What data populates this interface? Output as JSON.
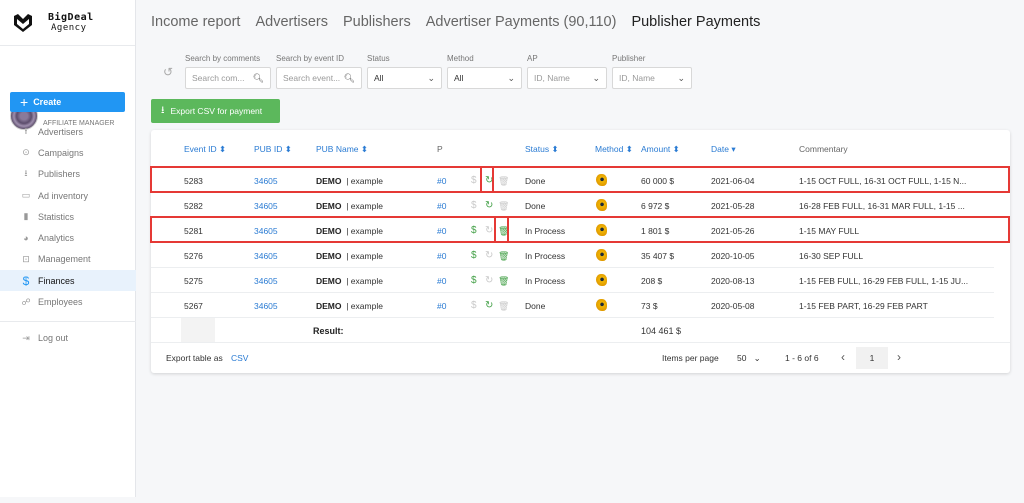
{
  "brand": {
    "line1": "BigDeal",
    "line2": "Agency"
  },
  "profile": {
    "role": "AFFILIATE MANAGER"
  },
  "sidebar": {
    "create_label": "Create",
    "items": [
      {
        "label": "Advertisers",
        "icon": "upload-icon"
      },
      {
        "label": "Campaigns",
        "icon": "play-circle-icon"
      },
      {
        "label": "Publishers",
        "icon": "download-icon"
      },
      {
        "label": "Ad inventory",
        "icon": "window-icon"
      },
      {
        "label": "Statistics",
        "icon": "bar-chart-icon"
      },
      {
        "label": "Analytics",
        "icon": "pie-chart-icon"
      },
      {
        "label": "Management",
        "icon": "settings-box-icon"
      },
      {
        "label": "Finances",
        "icon": "dollar-icon",
        "active": true
      },
      {
        "label": "Employees",
        "icon": "people-icon"
      }
    ],
    "logout_label": "Log out"
  },
  "tabs": [
    {
      "label": "Income report"
    },
    {
      "label": "Advertisers"
    },
    {
      "label": "Publishers"
    },
    {
      "label": "Advertiser Payments (90,110)"
    },
    {
      "label": "Publisher Payments",
      "active": true
    }
  ],
  "filters": {
    "comments": {
      "label": "Search by comments",
      "placeholder": "Search com..."
    },
    "event": {
      "label": "Search by event ID",
      "placeholder": "Search event..."
    },
    "status": {
      "label": "Status",
      "value": "All"
    },
    "method": {
      "label": "Method",
      "value": "All"
    },
    "ap": {
      "label": "AP",
      "placeholder": "ID, Name"
    },
    "publisher": {
      "label": "Publisher",
      "placeholder": "ID, Name"
    }
  },
  "export_button": "Export CSV for payment",
  "table": {
    "headers": {
      "event_id": "Event ID",
      "pub_id": "PUB ID",
      "pub_name": "PUB Name",
      "p": "P",
      "status": "Status",
      "method": "Method",
      "amount": "Amount",
      "date": "Date",
      "commentary": "Commentary"
    },
    "sort_icon": "⬍",
    "rows": [
      {
        "event_id": "5283",
        "pub_id": "34605",
        "pub_name": "DEMO",
        "pub_sub": "| example",
        "p": "#0",
        "status": "Done",
        "amount": "60 000 $",
        "date": "2021-06-04",
        "commentary": "1-15 OCT FULL, 16-31 OCT FULL, 1-15 N...",
        "pay_active": false,
        "revert_active": true,
        "delete_active": false,
        "highlighted": true
      },
      {
        "event_id": "5282",
        "pub_id": "34605",
        "pub_name": "DEMO",
        "pub_sub": "| example",
        "p": "#0",
        "status": "Done",
        "amount": "6 972 $",
        "date": "2021-05-28",
        "commentary": "16-28 FEB FULL, 16-31 MAR FULL, 1-15 ...",
        "pay_active": false,
        "revert_active": true,
        "delete_active": false,
        "highlighted": false
      },
      {
        "event_id": "5281",
        "pub_id": "34605",
        "pub_name": "DEMO",
        "pub_sub": "| example",
        "p": "#0",
        "status": "In Process",
        "amount": "1 801 $",
        "date": "2021-05-26",
        "commentary": "1-15 MAY FULL",
        "pay_active": true,
        "revert_active": false,
        "delete_active": true,
        "highlighted": true
      },
      {
        "event_id": "5276",
        "pub_id": "34605",
        "pub_name": "DEMO",
        "pub_sub": "| example",
        "p": "#0",
        "status": "In Process",
        "amount": "35 407 $",
        "date": "2020-10-05",
        "commentary": "16-30 SEP FULL",
        "pay_active": true,
        "revert_active": false,
        "delete_active": true,
        "highlighted": false
      },
      {
        "event_id": "5275",
        "pub_id": "34605",
        "pub_name": "DEMO",
        "pub_sub": "| example",
        "p": "#0",
        "status": "In Process",
        "amount": "208 $",
        "date": "2020-08-13",
        "commentary": "1-15 FEB FULL, 16-29 FEB FULL, 1-15 JU...",
        "pay_active": true,
        "revert_active": false,
        "delete_active": true,
        "highlighted": false
      },
      {
        "event_id": "5267",
        "pub_id": "34605",
        "pub_name": "DEMO",
        "pub_sub": "| example",
        "p": "#0",
        "status": "Done",
        "amount": "73 $",
        "date": "2020-05-08",
        "commentary": "1-15 FEB PART, 16-29 FEB PART",
        "pay_active": false,
        "revert_active": true,
        "delete_active": false,
        "highlighted": false
      }
    ],
    "result_label": "Result:",
    "result_total": "104 461 $"
  },
  "footer": {
    "export_label": "Export table as",
    "export_link": "CSV",
    "items_per_page_label": "Items per page",
    "items_per_page": "50",
    "range": "1 - 6 of 6",
    "page": "1"
  },
  "colors": {
    "accent": "#2196f3",
    "link": "#2a7bd3",
    "success": "#5cb85c",
    "highlight": "#e53935"
  }
}
